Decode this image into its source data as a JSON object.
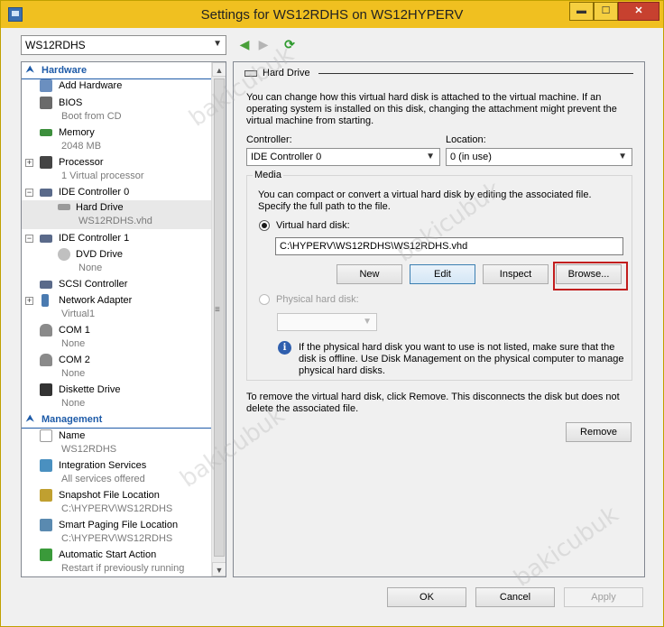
{
  "window": {
    "title": "Settings for WS12RDHS on WS12HYPERV",
    "min_glyph": "▬",
    "max_glyph": "☐",
    "close_glyph": "✕"
  },
  "vm_selector": {
    "value": "WS12RDHS"
  },
  "nav": {
    "back_glyph": "◀",
    "forward_glyph": "▶",
    "refresh_glyph": "⟳"
  },
  "tree": {
    "hardware_header": "Hardware",
    "management_header": "Management",
    "items": [
      {
        "label": "Add Hardware",
        "sub": "",
        "icon": "add-hardware-icon",
        "color": "#6b8fbf"
      },
      {
        "label": "BIOS",
        "sub": "Boot from CD",
        "icon": "bios-chip-icon",
        "color": "#6a6a6a"
      },
      {
        "label": "Memory",
        "sub": "2048 MB",
        "icon": "memory-icon",
        "color": "#3d8f3d"
      },
      {
        "label": "Processor",
        "sub": "1 Virtual processor",
        "icon": "processor-icon",
        "color": "#444444"
      },
      {
        "label": "IDE Controller 0",
        "sub": "",
        "icon": "ide-controller-icon",
        "color": "#5a6a8a"
      },
      {
        "label": "Hard Drive",
        "sub": "WS12RDHS.vhd",
        "icon": "hard-drive-icon",
        "color": "#8a8a8a"
      },
      {
        "label": "IDE Controller 1",
        "sub": "",
        "icon": "ide-controller-icon",
        "color": "#5a6a8a"
      },
      {
        "label": "DVD Drive",
        "sub": "None",
        "icon": "dvd-drive-icon",
        "color": "#b0b0b0"
      },
      {
        "label": "SCSI Controller",
        "sub": "",
        "icon": "scsi-controller-icon",
        "color": "#5a6a8a"
      },
      {
        "label": "Network Adapter",
        "sub": "Virtual1",
        "icon": "network-adapter-icon",
        "color": "#4a7ab0"
      },
      {
        "label": "COM 1",
        "sub": "None",
        "icon": "com-port-icon",
        "color": "#8a8a8a"
      },
      {
        "label": "COM 2",
        "sub": "None",
        "icon": "com-port-icon",
        "color": "#8a8a8a"
      },
      {
        "label": "Diskette Drive",
        "sub": "None",
        "icon": "diskette-icon",
        "color": "#333333"
      },
      {
        "label": "Name",
        "sub": "WS12RDHS",
        "icon": "name-icon",
        "color": "#9a9a9a"
      },
      {
        "label": "Integration Services",
        "sub": "All services offered",
        "icon": "integration-services-icon",
        "color": "#4a90c0"
      },
      {
        "label": "Snapshot File Location",
        "sub": "C:\\HYPERV\\WS12RDHS",
        "icon": "snapshot-location-icon",
        "color": "#c0a030"
      },
      {
        "label": "Smart Paging File Location",
        "sub": "C:\\HYPERV\\WS12RDHS",
        "icon": "smart-paging-icon",
        "color": "#5a8ab0"
      },
      {
        "label": "Automatic Start Action",
        "sub": "Restart if previously running",
        "icon": "automatic-start-icon",
        "color": "#3a9a3a"
      }
    ]
  },
  "panel": {
    "header": "Hard Drive",
    "intro": "You can change how this virtual hard disk is attached to the virtual machine. If an operating system is installed on this disk, changing the attachment might prevent the virtual machine from starting.",
    "controller_label": "Controller:",
    "controller_value": "IDE Controller 0",
    "location_label": "Location:",
    "location_value": "0 (in use)",
    "media_legend": "Media",
    "media_desc": "You can compact or convert a virtual hard disk by editing the associated file. Specify the full path to the file.",
    "vhd_radio_label": "Virtual hard disk:",
    "vhd_path": "C:\\HYPERV\\WS12RDHS\\WS12RDHS.vhd",
    "btn_new": "New",
    "btn_edit": "Edit",
    "btn_inspect": "Inspect",
    "btn_browse": "Browse...",
    "physical_radio_label": "Physical hard disk:",
    "physical_value": "",
    "physical_info": "If the physical hard disk you want to use is not listed, make sure that the disk is offline. Use Disk Management on the physical computer to manage physical hard disks.",
    "remove_desc": "To remove the virtual hard disk, click Remove. This disconnects the disk but does not delete the associated file.",
    "btn_remove": "Remove"
  },
  "footer": {
    "ok": "OK",
    "cancel": "Cancel",
    "apply": "Apply"
  },
  "watermark": "bakicubuk",
  "colors": {
    "titlebar": "#f0c020",
    "accent": "#1e5ba8",
    "highlight": "#c21e1e"
  }
}
